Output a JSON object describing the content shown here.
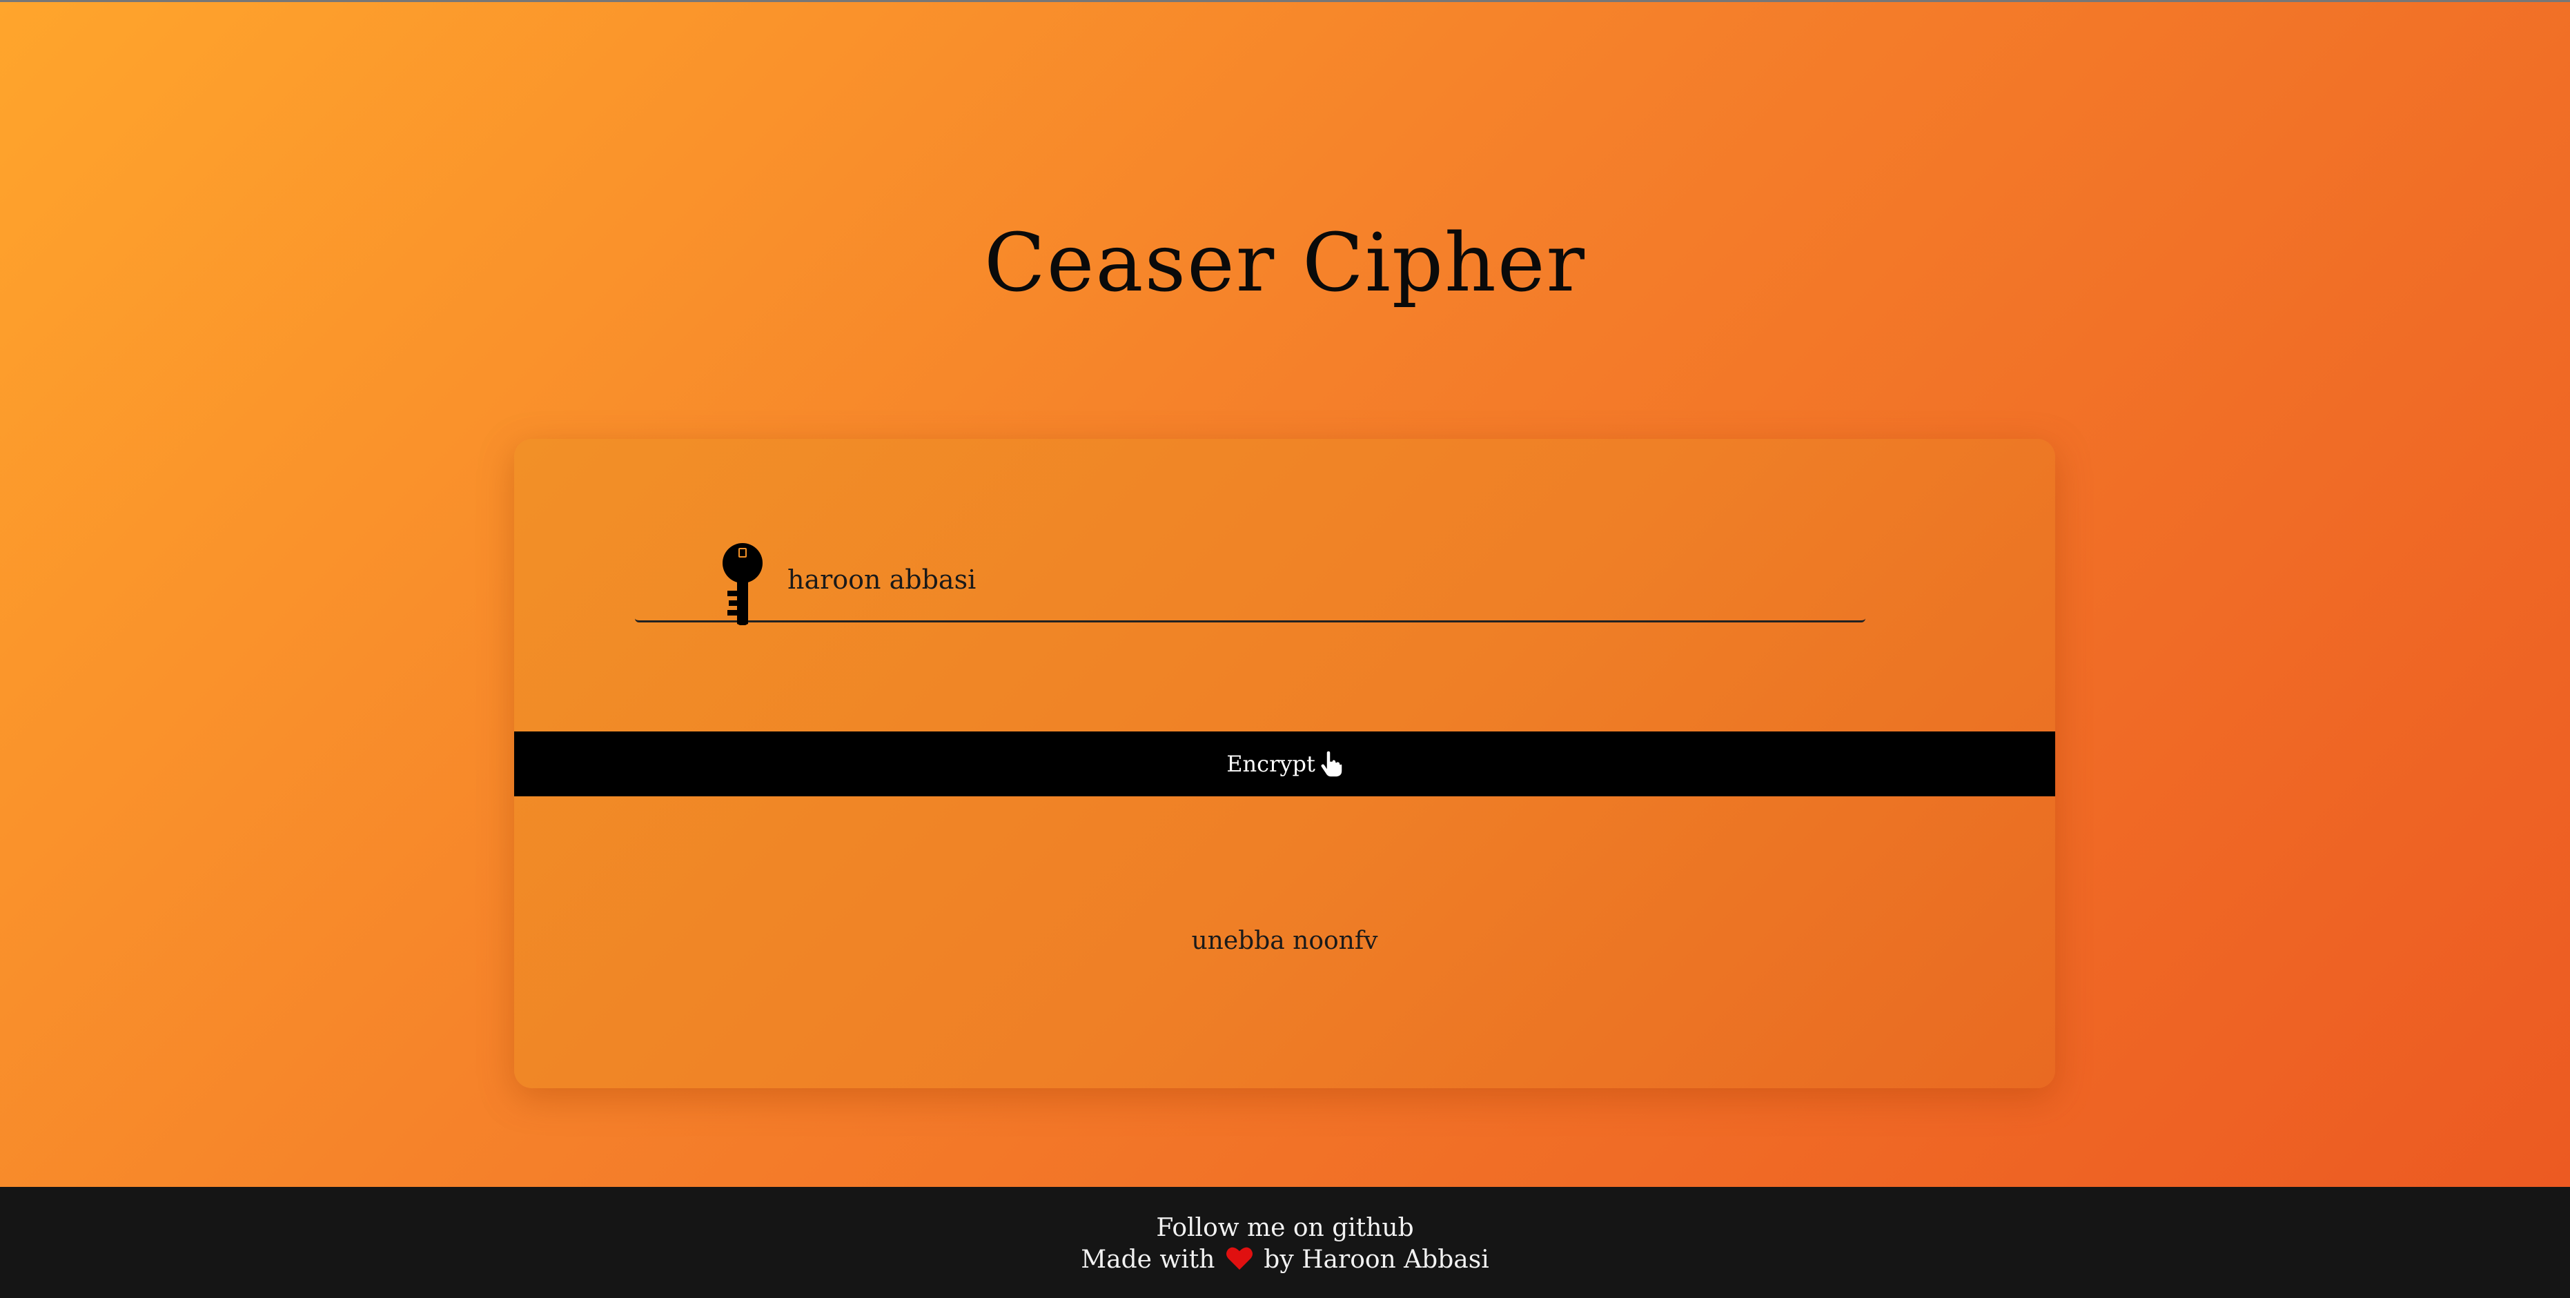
{
  "header": {
    "title": "Ceaser Cipher"
  },
  "form": {
    "icon": "key-icon",
    "input_value": "haroon abbasi",
    "encrypt_label": "Encrypt",
    "cursor_icon": "pointer-hand-icon",
    "output_text": "unebba noonfv"
  },
  "footer": {
    "follow_text": "Follow me on github",
    "made_with": "Made with",
    "heart_icon": "heart-icon",
    "by_text": "by Haroon Abbasi"
  },
  "colors": {
    "gradient_start": "#ffa52c",
    "gradient_end": "#ec5a22",
    "button_bg": "#000000",
    "footer_bg": "#151515",
    "heart": "#e01010"
  }
}
